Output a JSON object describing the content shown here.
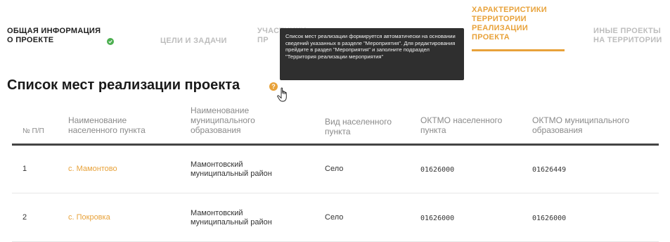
{
  "tabs": [
    {
      "line1": "ОБЩАЯ ИНФОРМАЦИЯ",
      "line2": "О ПРОЕКТЕ"
    },
    {
      "line1": "ЦЕЛИ И ЗАДАЧИ"
    },
    {
      "line1": "УЧАСТНИКИ",
      "line2": "ПР"
    },
    {
      "line1": "ХАРАКТЕРИСТИКИ",
      "line2": "ТЕРРИТОРИИ",
      "line3": "РЕАЛИЗАЦИИ",
      "line4": "ПРОЕКТА"
    },
    {
      "line1": "ИНЫЕ ПРОЕКТЫ",
      "line2": "НА ТЕРРИТОРИИ"
    }
  ],
  "tooltip": {
    "text": "Список мест реализации формируется автоматически на основании сведений указанных в разделе \"Мероприятия\". Для редактирования прейдите в раздел \"Мероприятия\" и заполните подраздел \"Территория реализации мероприятия\""
  },
  "page": {
    "title": "Список мест реализации проекта",
    "help": "?"
  },
  "table": {
    "headers": [
      "№ П/П",
      "Наименование населенного пункта",
      "Наименование муниципального образования",
      "Вид населенного пункта",
      "ОКТМО населенного пункта",
      "ОКТМО муниципального образования"
    ],
    "rows": [
      {
        "num": "1",
        "settlement": "с. Мамонтово",
        "municipality": "Мамонтовский муниципальный район",
        "type": "Село",
        "oktmo_settlement": "01626000",
        "oktmo_municipality": "01626449"
      },
      {
        "num": "2",
        "settlement": "с. Покровка",
        "municipality": "Мамонтовский муниципальный район",
        "type": "Село",
        "oktmo_settlement": "01626000",
        "oktmo_municipality": "01626000"
      }
    ]
  },
  "colors": {
    "accent": "#e8a23a",
    "success": "#4caf50",
    "tooltip_bg": "#2f2f2f"
  }
}
